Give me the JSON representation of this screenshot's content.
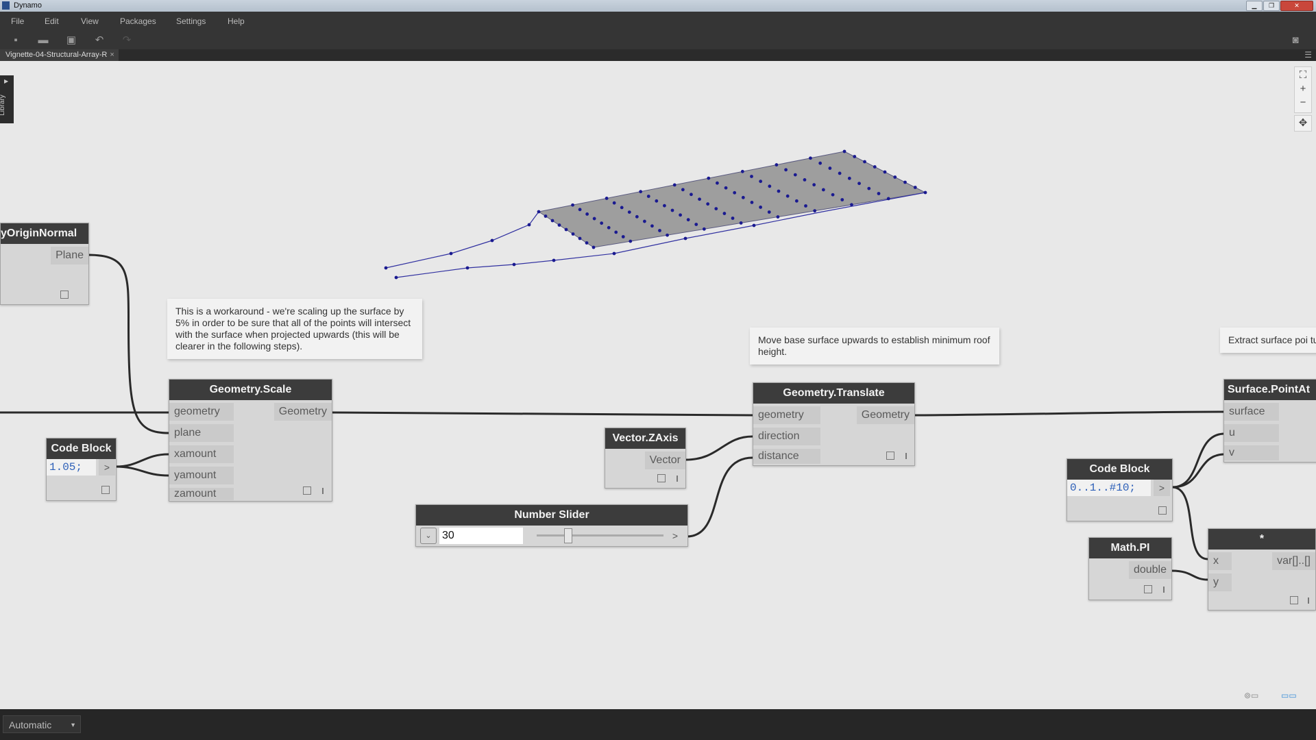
{
  "window": {
    "title": "Dynamo"
  },
  "menu": [
    "File",
    "Edit",
    "View",
    "Packages",
    "Settings",
    "Help"
  ],
  "tab": {
    "label": "Vignette-04-Structural-Array-R",
    "close": "×"
  },
  "library": {
    "label": "Library"
  },
  "notes": {
    "scale": "This is a workaround - we're scaling up the surface by 5% in order to be sure that all of the points will intersect with the surface when projected upwards (this will be clearer in the following steps).",
    "translate": "Move base surface upwards to establish minimum roof height.",
    "extract": "Extract surface poi turn Lacing to \"Cro"
  },
  "nodes": {
    "byorigin": {
      "title": "yOriginNormal",
      "out": "Plane"
    },
    "codeblock1": {
      "title": "Code Block",
      "code": "1.05;",
      "out": ">"
    },
    "scale": {
      "title": "Geometry.Scale",
      "inputs": [
        "geometry",
        "plane",
        "xamount",
        "yamount",
        "zamount"
      ],
      "out": "Geometry"
    },
    "zaxis": {
      "title": "Vector.ZAxis",
      "out": "Vector"
    },
    "slider": {
      "title": "Number Slider",
      "value": "30",
      "out": ">",
      "level": 0.23
    },
    "translate": {
      "title": "Geometry.Translate",
      "inputs": [
        "geometry",
        "direction",
        "distance"
      ],
      "out": "Geometry"
    },
    "codeblock2": {
      "title": "Code Block",
      "code": "0..1..#10;",
      "out": ">"
    },
    "pointat": {
      "title": "Surface.PointAt",
      "inputs": [
        "surface",
        "u",
        "v"
      ]
    },
    "mathpi": {
      "title": "Math.PI",
      "out": "double"
    },
    "multiply": {
      "title": "*",
      "inputs": [
        "x",
        "y"
      ],
      "out": "var[]..[]"
    }
  },
  "runmode": {
    "value": "Automatic"
  },
  "colors": {
    "chrome": "#353535",
    "node_header": "#3c3c3c",
    "node_body": "#d6d6d6",
    "canvas": "#e8e8e8",
    "code": "#2c5fb8",
    "geometry_point": "#2020a0",
    "surface": "#9e9e9e"
  }
}
